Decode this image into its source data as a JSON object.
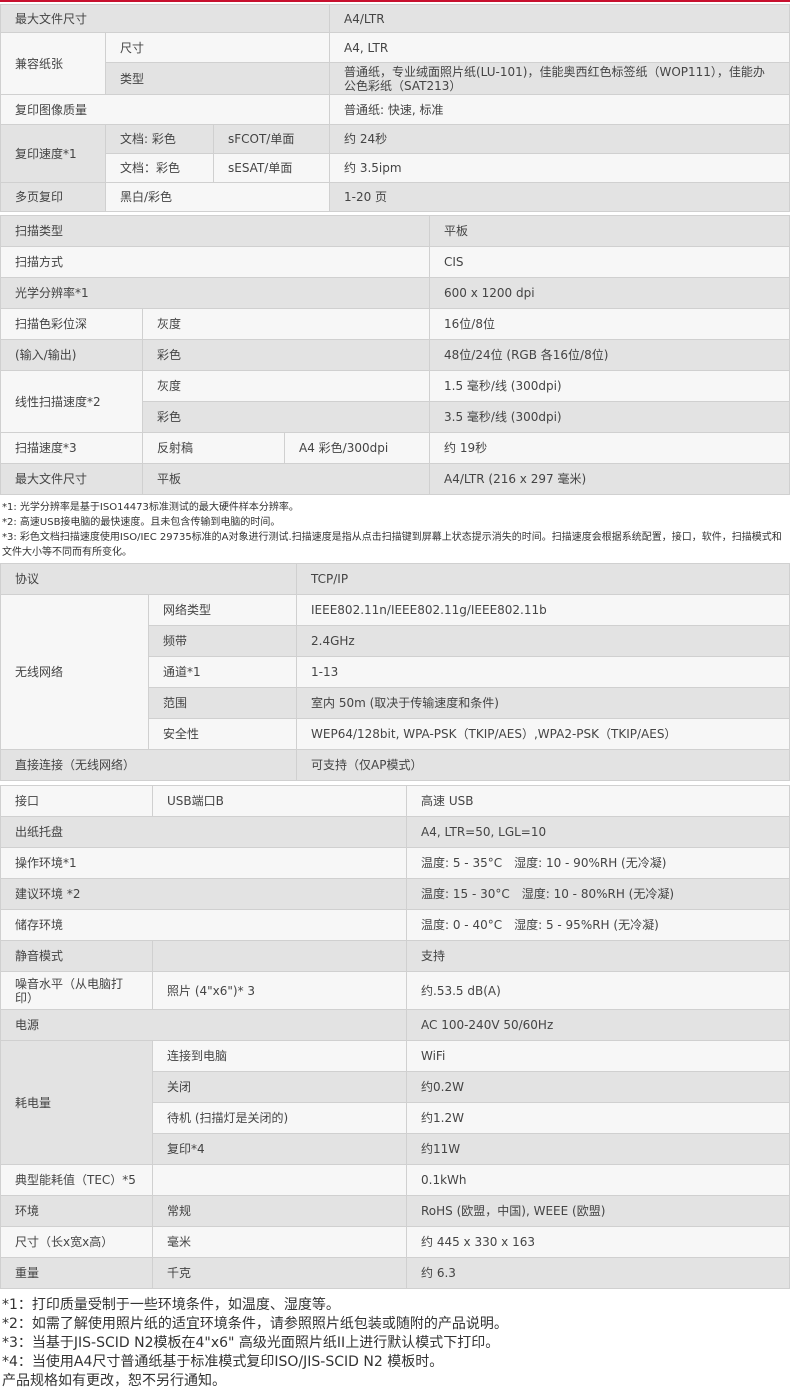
{
  "copy": {
    "max_file_size_label": "最大文件尺寸",
    "max_file_size_value": "A4/LTR",
    "paper_label": "兼容纸张",
    "paper_size_label": "尺寸",
    "paper_size_value": "A4, LTR",
    "paper_type_label": "类型",
    "paper_type_value": "普通纸，专业绒面照片纸(LU-101)，佳能奥西红色标签纸（WOP111），佳能办公色彩纸（SAT213）",
    "quality_label": "复印图像质量",
    "quality_value": "普通纸: 快速, 标准",
    "speed_label": "复印速度*1",
    "speed_row1_doc": "文档: 彩色",
    "speed_row1_metric": "sFCOT/单面",
    "speed_row1_value": "约 24秒",
    "speed_row2_doc": "文档：彩色",
    "speed_row2_metric": "sESAT/单面",
    "speed_row2_value": "约 3.5ipm",
    "multi_label": "多页复印",
    "multi_mode": "黑白/彩色",
    "multi_value": "1-20 页"
  },
  "scan": {
    "type_label": "扫描类型",
    "type_value": "平板",
    "method_label": "扫描方式",
    "method_value": "CIS",
    "resolution_label": "光学分辨率*1",
    "resolution_value": "600 x 1200 dpi",
    "depth_label1": "扫描色彩位深",
    "depth_gray_label": "灰度",
    "depth_gray_value": "16位/8位",
    "depth_label2": "(输入/输出)",
    "depth_color_label": "彩色",
    "depth_color_value": "48位/24位 (RGB 各16位/8位)",
    "line_label": "线性扫描速度*2",
    "line_gray_label": "灰度",
    "line_gray_value": "1.5 毫秒/线 (300dpi)",
    "line_color_label": "彩色",
    "line_color_value": "3.5 毫秒/线 (300dpi)",
    "speed_label": "扫描速度*3",
    "speed_doc": "反射稿",
    "speed_mode": "A4 彩色/300dpi",
    "speed_value": "约 19秒",
    "maxsize_label": "最大文件尺寸",
    "maxsize_type": "平板",
    "maxsize_value": "A4/LTR (216 x 297 毫米)"
  },
  "scan_notes": [
    "*1: 光学分辨率是基于ISO14473标准测试的最大硬件样本分辨率。",
    "*2: 高速USB接电脑的最快速度。且未包含传输到电脑的时间。",
    "*3: 彩色文档扫描速度使用ISO/IEC 29735标准的A对象进行测试.扫描速度是指从点击扫描键到屏幕上状态提示消失的时间。扫描速度会根据系统配置，接口，软件，扫描模式和文件大小等不同而有所变化。"
  ],
  "network": {
    "protocol_label": "协议",
    "protocol_value": "TCP/IP",
    "wireless_label": "无线网络",
    "rows": [
      {
        "label": "网络类型",
        "value": "IEEE802.11n/IEEE802.11g/IEEE802.11b"
      },
      {
        "label": "频带",
        "value": "2.4GHz"
      },
      {
        "label": "通道*1",
        "value": "1-13"
      },
      {
        "label": "范围",
        "value": "室内 50m (取决于传输速度和条件)"
      },
      {
        "label": "安全性",
        "value": "WEP64/128bit, WPA-PSK（TKIP/AES）,WPA2-PSK（TKIP/AES）"
      }
    ],
    "direct_label": "直接连接（无线网络）",
    "direct_value": "可支持（仅AP模式）"
  },
  "general": {
    "interface_label": "接口",
    "interface_port": "USB端口B",
    "interface_value": "高速 USB",
    "tray_label": "出纸托盘",
    "tray_value": "A4, LTR=50, LGL=10",
    "op_env_label": "操作环境*1",
    "op_env_value": "温度: 5 - 35°C　湿度: 10 - 90%RH (无冷凝)",
    "rec_env_label": "建议环境 *2",
    "rec_env_value": "温度: 15 - 30°C　湿度: 10 - 80%RH (无冷凝)",
    "store_env_label": "储存环境",
    "store_env_value": "温度: 0 - 40°C　湿度: 5 - 95%RH (无冷凝)",
    "quiet_label": "静音模式",
    "quiet_value": "支持",
    "noise_label": "噪音水平（从电脑打印）",
    "noise_cond": "照片 (4\"x6\")* 3",
    "noise_value": "约.53.5 dB(A)",
    "power_label": "电源",
    "power_value": "AC 100-240V 50/60Hz",
    "consumption_label": "耗电量",
    "consumption_rows": [
      {
        "label": "连接到电脑",
        "value": "WiFi"
      },
      {
        "label": "关闭",
        "value": "约0.2W"
      },
      {
        "label": "待机 (扫描灯是关闭的)",
        "value": "约1.2W"
      },
      {
        "label": "复印*4",
        "value": "约11W"
      }
    ],
    "tec_label": "典型能耗值（TEC）*5",
    "tec_value": "0.1kWh",
    "environment_label": "环境",
    "environment_type": "常规",
    "environment_value": "RoHS (欧盟，中国), WEEE (欧盟)",
    "dimension_label": "尺寸（长x宽x高）",
    "dimension_unit": "毫米",
    "dimension_value": "约 445 x 330 x 163",
    "weight_label": "重量",
    "weight_unit": "千克",
    "weight_value": "约 6.3"
  },
  "footnotes": [
    "*1：打印质量受制于一些环境条件，如温度、湿度等。",
    "*2：如需了解使用照片纸的适宜环境条件，请参照照片纸包装或随附的产品说明。",
    "*3：当基于JIS-SCID N2模板在4\"x6\" 高级光面照片纸II上进行默认模式下打印。",
    "*4：当使用A4尺寸普通纸基于标准模式复印ISO/JIS-SCID N2 模板时。",
    "产品规格如有更改，恕不另行通知。"
  ],
  "colors": {
    "accent_line": "#c8102e",
    "row_dark": "#e3e3e3",
    "row_light": "#f7f7f7"
  }
}
